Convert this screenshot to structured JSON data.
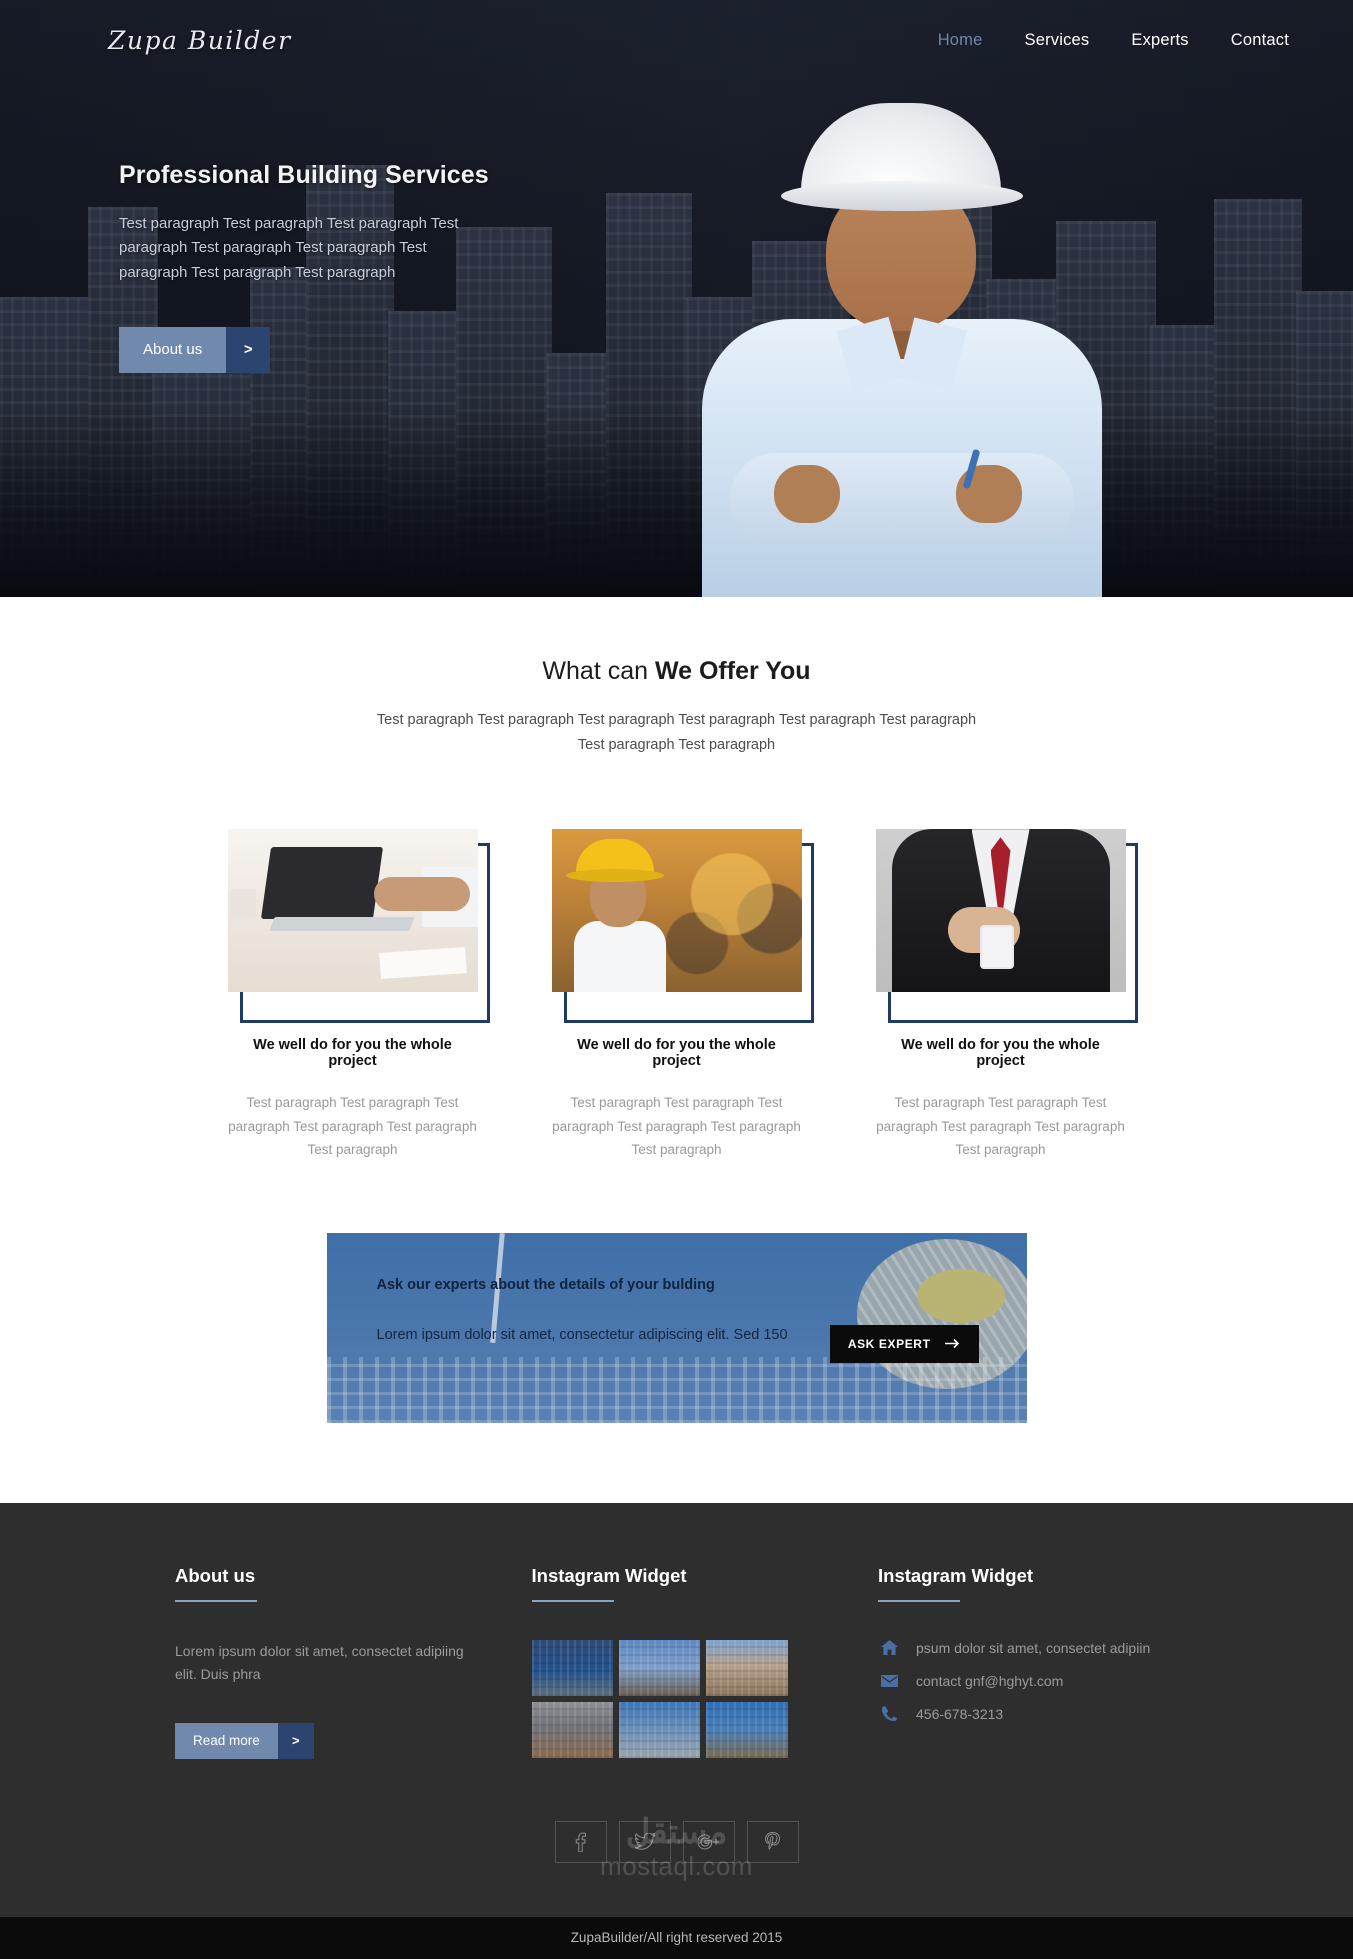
{
  "brand": {
    "logo": "Zupa Builder"
  },
  "nav": {
    "items": [
      {
        "label": "Home",
        "active": true
      },
      {
        "label": "Services",
        "active": false
      },
      {
        "label": "Experts",
        "active": false
      },
      {
        "label": "Contact",
        "active": false
      }
    ]
  },
  "hero": {
    "title": "Professional Building Services",
    "paragraph": "Test paragraph Test paragraph Test paragraph Test paragraph Test paragraph Test paragraph Test paragraph Test paragraph Test paragraph",
    "button_label": "About us",
    "button_arrow": ">"
  },
  "offer": {
    "heading_light": "What can ",
    "heading_bold": "We Offer You",
    "subtitle": "Test paragraph Test paragraph Test paragraph Test paragraph Test paragraph Test paragraph Test paragraph Test paragraph",
    "cards": [
      {
        "image_name": "laptop-desk-photo",
        "title": "We well do for you the whole project",
        "text": "Test paragraph Test paragraph Test paragraph Test paragraph Test paragraph Test paragraph"
      },
      {
        "image_name": "construction-worker-photo",
        "title": "We well do for you the whole project",
        "text": "Test paragraph Test paragraph Test paragraph Test paragraph Test paragraph Test paragraph"
      },
      {
        "image_name": "handing-keys-photo",
        "title": "We well do for you the whole project",
        "text": "Test paragraph Test paragraph Test paragraph Test paragraph Test paragraph Test paragraph"
      }
    ]
  },
  "cta": {
    "heading": "Ask our experts about the details of your bulding",
    "paragraph": "Lorem ipsum dolor sit amet, consectetur adipiscing elit. Sed 150",
    "button_label": "ASK EXPERT",
    "button_icon": "arrow-right-icon"
  },
  "footer": {
    "about": {
      "heading": "About us",
      "text": "Lorem ipsum dolor sit amet, consectet adipiing elit. Duis phra",
      "button_label": "Read more",
      "button_arrow": ">"
    },
    "instagram": {
      "heading": "Instagram Widget",
      "thumbs": [
        "workers-group-thumb",
        "city-skyline-thumb",
        "old-building-thumb",
        "modern-house-thumb",
        "highrise-towers-thumb",
        "two-engineers-thumb"
      ]
    },
    "contact": {
      "heading": "Instagram Widget",
      "rows": [
        {
          "icon": "home-icon",
          "value": "psum dolor sit amet, consectet adipiin"
        },
        {
          "icon": "envelope-icon",
          "value": "contact gnf@hghyt.com"
        },
        {
          "icon": "phone-icon",
          "value": "456-678-3213"
        }
      ]
    },
    "socials": [
      {
        "name": "facebook-icon",
        "glyph": "f"
      },
      {
        "name": "twitter-icon",
        "glyph": "t"
      },
      {
        "name": "google-plus-icon",
        "glyph": "g"
      },
      {
        "name": "pinterest-icon",
        "glyph": "p"
      }
    ],
    "watermark": {
      "arabic": "مستقل",
      "latin": "mostaql.com"
    },
    "copyright": "ZupaBuilder/All right reserved 2015"
  },
  "colors": {
    "accent_blue": "#7089ad",
    "accent_dark": "#2b4470",
    "footer_bg": "#2e2e2e",
    "frame_navy": "#1f3a63"
  }
}
